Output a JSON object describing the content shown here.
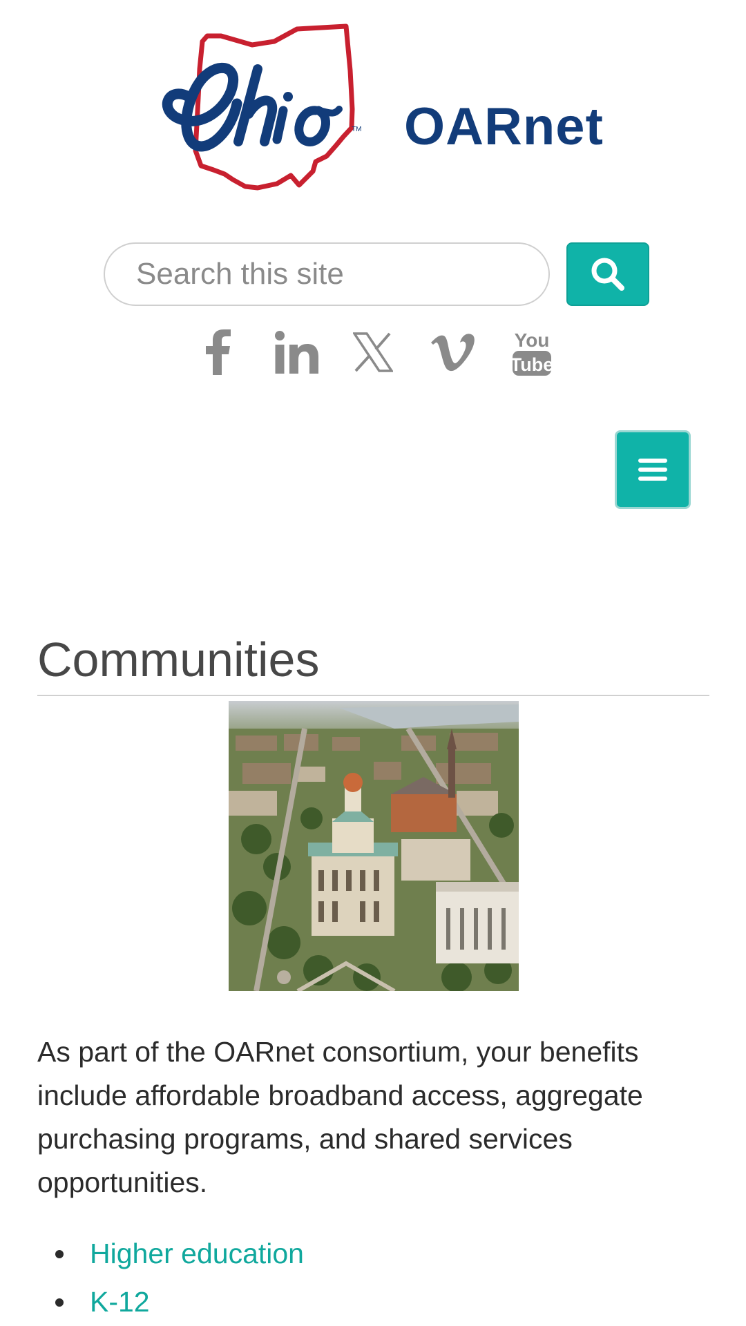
{
  "header": {
    "logo_text": "Ohio",
    "brand_name": "OARnet"
  },
  "search": {
    "placeholder": "Search this site",
    "value": "",
    "button_icon": "search-icon"
  },
  "social": [
    {
      "name": "Facebook",
      "icon": "facebook-icon"
    },
    {
      "name": "LinkedIn",
      "icon": "linkedin-icon"
    },
    {
      "name": "X",
      "icon": "x-icon"
    },
    {
      "name": "Vimeo",
      "icon": "vimeo-icon"
    },
    {
      "name": "YouTube",
      "icon": "youtube-icon",
      "glyph_top": "You",
      "glyph_bottom": "Tube"
    }
  ],
  "menu": {
    "icon": "hamburger-menu-icon"
  },
  "content": {
    "title": "Communities",
    "intro": "As part of the OARnet consortium, your benefits include affordable broadband access, aggregate purchasing programs, and shared services opportunities.",
    "links": [
      {
        "label": "Higher education"
      },
      {
        "label": "K-12"
      }
    ]
  },
  "colors": {
    "accent": "#10b3a8",
    "link": "#10a89d",
    "brand_blue": "#123c7a",
    "brand_red": "#c8202f",
    "icon_gray": "#8a8a8a"
  }
}
